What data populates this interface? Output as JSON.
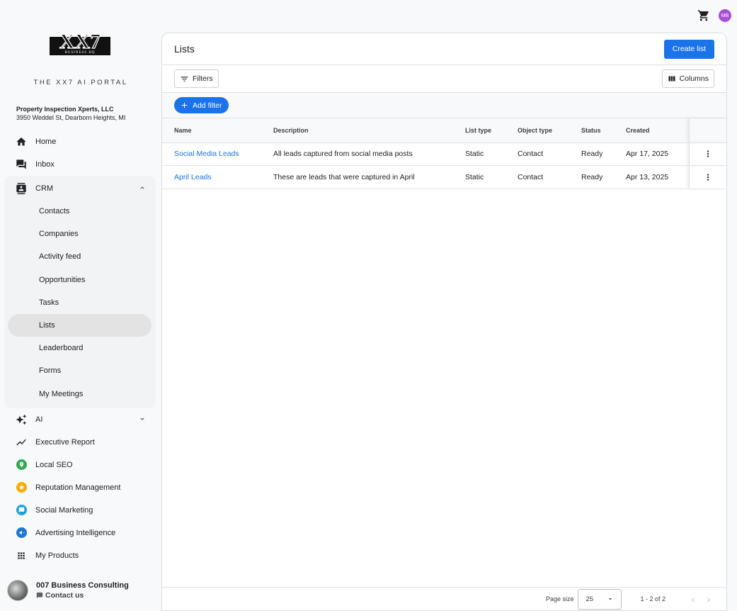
{
  "app": {
    "portal_title": "THE XX7 AI PORTAL",
    "logo_text": "XX7",
    "logo_subtext": "BUSINESS HQ",
    "company_name": "Property Inspection Xperts, LLC",
    "company_address": "3950 Weddel St, Dearborn Heights, MI",
    "avatar_initials": "MB",
    "colors": {
      "accent": "#1a73e8",
      "avatar": "#a94fd6"
    }
  },
  "nav": {
    "home": "Home",
    "inbox": "Inbox",
    "crm": "CRM",
    "crm_items": [
      "Contacts",
      "Companies",
      "Activity feed",
      "Opportunities",
      "Tasks",
      "Lists",
      "Leaderboard",
      "Forms",
      "My Meetings"
    ],
    "ai": "AI",
    "executive_report": "Executive Report",
    "local_seo": "Local SEO",
    "reputation": "Reputation Management",
    "social": "Social Marketing",
    "advertising": "Advertising Intelligence",
    "my_products": "My Products"
  },
  "footer": {
    "name": "007 Business Consulting",
    "contact": "Contact us"
  },
  "page": {
    "title": "Lists",
    "create_button": "Create list",
    "filters_button": "Filters",
    "columns_button": "Columns",
    "add_filter_button": "Add filter"
  },
  "table": {
    "headers": [
      "Name",
      "Description",
      "List type",
      "Object type",
      "Status",
      "Created"
    ],
    "rows": [
      [
        "Social Media Leads",
        "All leads captured from social media posts",
        "Static",
        "Contact",
        "Ready",
        "Apr 17, 2025"
      ],
      [
        "April Leads",
        "These are leads that were captured in April",
        "Static",
        "Contact",
        "Ready",
        "Apr 13, 2025"
      ]
    ]
  },
  "pagination": {
    "page_size_label": "Page size",
    "page_size": "25",
    "range": "1 - 2 of 2"
  }
}
